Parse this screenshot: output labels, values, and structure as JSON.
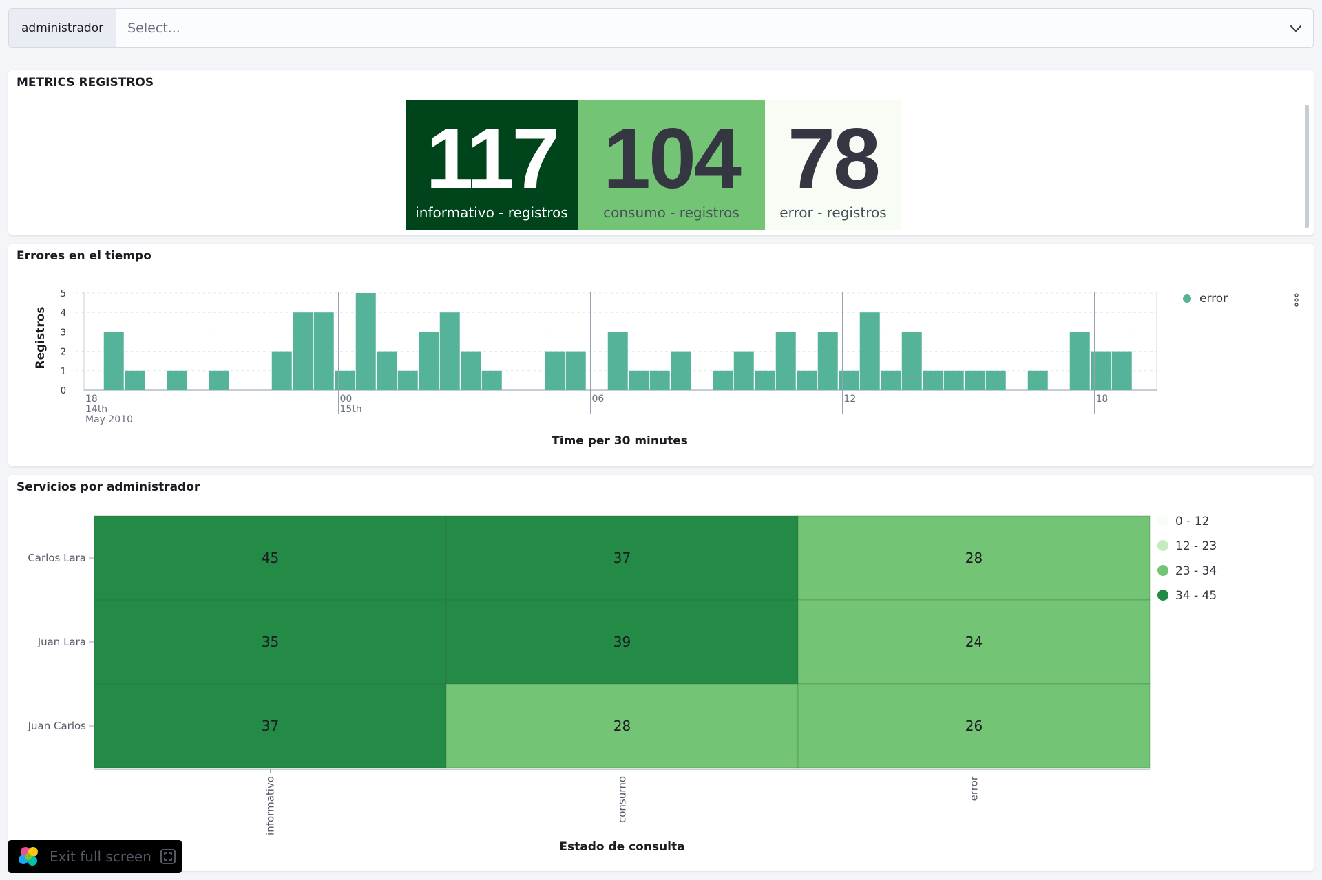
{
  "filter": {
    "label": "administrador",
    "placeholder": "Select..."
  },
  "panels": {
    "metrics_title": "METRICS REGISTROS",
    "timeline_title": "Errores en el tiempo",
    "heatmap_title": "Servicios por administrador"
  },
  "metrics": [
    {
      "value": "117",
      "label": "informativo - registros",
      "color": "#00441b"
    },
    {
      "value": "104",
      "label": "consumo - registros",
      "color": "#74c476"
    },
    {
      "value": "78",
      "label": "error - registros",
      "color": "#f7fcf5"
    }
  ],
  "exit_fullscreen": {
    "label": "Exit full screen"
  },
  "colors": {
    "bar": "#54b399",
    "heat_0_12": "#f7fcf5",
    "heat_12_23": "#c7e9c0",
    "heat_23_34": "#74c476",
    "heat_34_45": "#238b45"
  },
  "chart_data": [
    {
      "type": "bar",
      "title": "Errores en el tiempo",
      "xlabel": "Time per 30 minutes",
      "ylabel": "Registros",
      "ylim": [
        0,
        5
      ],
      "yticks": [
        "0",
        "1",
        "2",
        "3",
        "4",
        "5"
      ],
      "xticks": [
        {
          "slot": 0,
          "lines": [
            "18",
            "14th",
            "May 2010"
          ]
        },
        {
          "slot": 11,
          "lines": [
            "00",
            "15th"
          ]
        },
        {
          "slot": 23,
          "lines": [
            "06"
          ]
        },
        {
          "slot": 35,
          "lines": [
            "12"
          ]
        },
        {
          "slot": 47,
          "lines": [
            "18"
          ]
        }
      ],
      "grid": true,
      "legend": "top-right",
      "series": [
        {
          "name": "error",
          "values": [
            3,
            1,
            0,
            1,
            0,
            1,
            0,
            0,
            2,
            4,
            4,
            1,
            5,
            2,
            1,
            3,
            4,
            2,
            1,
            0,
            0,
            2,
            2,
            0,
            3,
            1,
            1,
            2,
            0,
            1,
            2,
            1,
            3,
            1,
            3,
            1,
            4,
            1,
            3,
            1,
            1,
            1,
            1,
            0,
            1,
            0,
            3,
            2,
            2
          ]
        }
      ]
    },
    {
      "type": "heatmap",
      "title": "Servicios por administrador",
      "xlabel": "Estado de consulta",
      "ylabel": "",
      "categories": [
        "informativo",
        "consumo",
        "error"
      ],
      "rows": [
        "Carlos Lara",
        "Juan Lara",
        "Juan Carlos"
      ],
      "values": [
        [
          45,
          37,
          28
        ],
        [
          35,
          39,
          24
        ],
        [
          37,
          28,
          26
        ]
      ],
      "legend": "top-right",
      "legend_ranges": [
        "0 - 12",
        "12 - 23",
        "23 - 34",
        "34 - 45"
      ],
      "legend_colors": [
        "#f7fcf5",
        "#c7e9c0",
        "#74c476",
        "#238b45"
      ]
    }
  ]
}
